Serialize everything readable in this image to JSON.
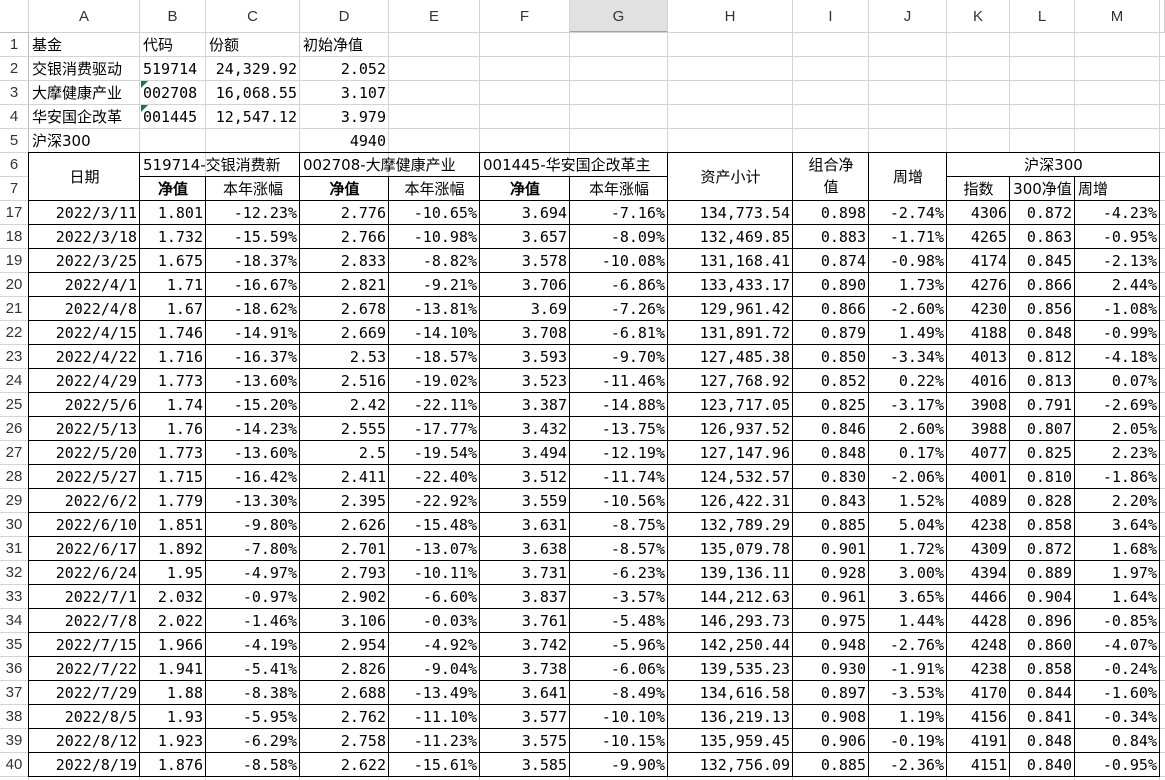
{
  "columns": [
    "A",
    "B",
    "C",
    "D",
    "E",
    "F",
    "G",
    "H",
    "I",
    "J",
    "K",
    "L",
    "M"
  ],
  "info_rows": {
    "row_numbers": [
      "1",
      "2",
      "3",
      "4",
      "5"
    ],
    "header": {
      "fund": "基金",
      "code": "代码",
      "shares": "份额",
      "init_nav": "初始净值"
    },
    "funds": [
      {
        "name": "交银消费驱动",
        "code": "519714",
        "shares": "24,329.92",
        "nav": "2.052"
      },
      {
        "name": "大摩健康产业",
        "code": "002708",
        "shares": "16,068.55",
        "nav": "3.107"
      },
      {
        "name": "华安国企改革",
        "code": "001445",
        "shares": "12,547.12",
        "nav": "3.979"
      }
    ],
    "index": {
      "name": "沪深300",
      "value": "4940"
    }
  },
  "table_header": {
    "row6": "6",
    "row7": "7",
    "date": "日期",
    "fund1": "519714-交银消费新",
    "fund2": "002708-大摩健康产业",
    "fund3": "001445-华安国企改革主",
    "nav": "净值",
    "ytd": "本年涨幅",
    "subtotal": "资产小计",
    "portfolio_nav": "组合净值",
    "weekly": "周增",
    "hs300": "沪深300",
    "index": "指数",
    "hs300_nav": "300净值",
    "hs300_weekly": "周增"
  },
  "rows": [
    [
      "17",
      "2022/3/11",
      "1.801",
      "-12.23%",
      "2.776",
      "-10.65%",
      "3.694",
      "-7.16%",
      "134,773.54",
      "0.898",
      "-2.74%",
      "4306",
      "0.872",
      "-4.23%"
    ],
    [
      "18",
      "2022/3/18",
      "1.732",
      "-15.59%",
      "2.766",
      "-10.98%",
      "3.657",
      "-8.09%",
      "132,469.85",
      "0.883",
      "-1.71%",
      "4265",
      "0.863",
      "-0.95%"
    ],
    [
      "19",
      "2022/3/25",
      "1.675",
      "-18.37%",
      "2.833",
      "-8.82%",
      "3.578",
      "-10.08%",
      "131,168.41",
      "0.874",
      "-0.98%",
      "4174",
      "0.845",
      "-2.13%"
    ],
    [
      "20",
      "2022/4/1",
      "1.71",
      "-16.67%",
      "2.821",
      "-9.21%",
      "3.706",
      "-6.86%",
      "133,433.17",
      "0.890",
      "1.73%",
      "4276",
      "0.866",
      "2.44%"
    ],
    [
      "21",
      "2022/4/8",
      "1.67",
      "-18.62%",
      "2.678",
      "-13.81%",
      "3.69",
      "-7.26%",
      "129,961.42",
      "0.866",
      "-2.60%",
      "4230",
      "0.856",
      "-1.08%"
    ],
    [
      "22",
      "2022/4/15",
      "1.746",
      "-14.91%",
      "2.669",
      "-14.10%",
      "3.708",
      "-6.81%",
      "131,891.72",
      "0.879",
      "1.49%",
      "4188",
      "0.848",
      "-0.99%"
    ],
    [
      "23",
      "2022/4/22",
      "1.716",
      "-16.37%",
      "2.53",
      "-18.57%",
      "3.593",
      "-9.70%",
      "127,485.38",
      "0.850",
      "-3.34%",
      "4013",
      "0.812",
      "-4.18%"
    ],
    [
      "24",
      "2022/4/29",
      "1.773",
      "-13.60%",
      "2.516",
      "-19.02%",
      "3.523",
      "-11.46%",
      "127,768.92",
      "0.852",
      "0.22%",
      "4016",
      "0.813",
      "0.07%"
    ],
    [
      "25",
      "2022/5/6",
      "1.74",
      "-15.20%",
      "2.42",
      "-22.11%",
      "3.387",
      "-14.88%",
      "123,717.05",
      "0.825",
      "-3.17%",
      "3908",
      "0.791",
      "-2.69%"
    ],
    [
      "26",
      "2022/5/13",
      "1.76",
      "-14.23%",
      "2.555",
      "-17.77%",
      "3.432",
      "-13.75%",
      "126,937.52",
      "0.846",
      "2.60%",
      "3988",
      "0.807",
      "2.05%"
    ],
    [
      "27",
      "2022/5/20",
      "1.773",
      "-13.60%",
      "2.5",
      "-19.54%",
      "3.494",
      "-12.19%",
      "127,147.96",
      "0.848",
      "0.17%",
      "4077",
      "0.825",
      "2.23%"
    ],
    [
      "28",
      "2022/5/27",
      "1.715",
      "-16.42%",
      "2.411",
      "-22.40%",
      "3.512",
      "-11.74%",
      "124,532.57",
      "0.830",
      "-2.06%",
      "4001",
      "0.810",
      "-1.86%"
    ],
    [
      "29",
      "2022/6/2",
      "1.779",
      "-13.30%",
      "2.395",
      "-22.92%",
      "3.559",
      "-10.56%",
      "126,422.31",
      "0.843",
      "1.52%",
      "4089",
      "0.828",
      "2.20%"
    ],
    [
      "30",
      "2022/6/10",
      "1.851",
      "-9.80%",
      "2.626",
      "-15.48%",
      "3.631",
      "-8.75%",
      "132,789.29",
      "0.885",
      "5.04%",
      "4238",
      "0.858",
      "3.64%"
    ],
    [
      "31",
      "2022/6/17",
      "1.892",
      "-7.80%",
      "2.701",
      "-13.07%",
      "3.638",
      "-8.57%",
      "135,079.78",
      "0.901",
      "1.72%",
      "4309",
      "0.872",
      "1.68%"
    ],
    [
      "32",
      "2022/6/24",
      "1.95",
      "-4.97%",
      "2.793",
      "-10.11%",
      "3.731",
      "-6.23%",
      "139,136.11",
      "0.928",
      "3.00%",
      "4394",
      "0.889",
      "1.97%"
    ],
    [
      "33",
      "2022/7/1",
      "2.032",
      "-0.97%",
      "2.902",
      "-6.60%",
      "3.837",
      "-3.57%",
      "144,212.63",
      "0.961",
      "3.65%",
      "4466",
      "0.904",
      "1.64%"
    ],
    [
      "34",
      "2022/7/8",
      "2.022",
      "-1.46%",
      "3.106",
      "-0.03%",
      "3.761",
      "-5.48%",
      "146,293.73",
      "0.975",
      "1.44%",
      "4428",
      "0.896",
      "-0.85%"
    ],
    [
      "35",
      "2022/7/15",
      "1.966",
      "-4.19%",
      "2.954",
      "-4.92%",
      "3.742",
      "-5.96%",
      "142,250.44",
      "0.948",
      "-2.76%",
      "4248",
      "0.860",
      "-4.07%"
    ],
    [
      "36",
      "2022/7/22",
      "1.941",
      "-5.41%",
      "2.826",
      "-9.04%",
      "3.738",
      "-6.06%",
      "139,535.23",
      "0.930",
      "-1.91%",
      "4238",
      "0.858",
      "-0.24%"
    ],
    [
      "37",
      "2022/7/29",
      "1.88",
      "-8.38%",
      "2.688",
      "-13.49%",
      "3.641",
      "-8.49%",
      "134,616.58",
      "0.897",
      "-3.53%",
      "4170",
      "0.844",
      "-1.60%"
    ],
    [
      "38",
      "2022/8/5",
      "1.93",
      "-5.95%",
      "2.762",
      "-11.10%",
      "3.577",
      "-10.10%",
      "136,219.13",
      "0.908",
      "1.19%",
      "4156",
      "0.841",
      "-0.34%"
    ],
    [
      "39",
      "2022/8/12",
      "1.923",
      "-6.29%",
      "2.758",
      "-11.23%",
      "3.575",
      "-10.15%",
      "135,959.45",
      "0.906",
      "-0.19%",
      "4191",
      "0.848",
      "0.84%"
    ],
    [
      "40",
      "2022/8/19",
      "1.876",
      "-8.58%",
      "2.622",
      "-15.61%",
      "3.585",
      "-9.90%",
      "132,756.09",
      "0.885",
      "-2.36%",
      "4151",
      "0.840",
      "-0.95%"
    ]
  ]
}
